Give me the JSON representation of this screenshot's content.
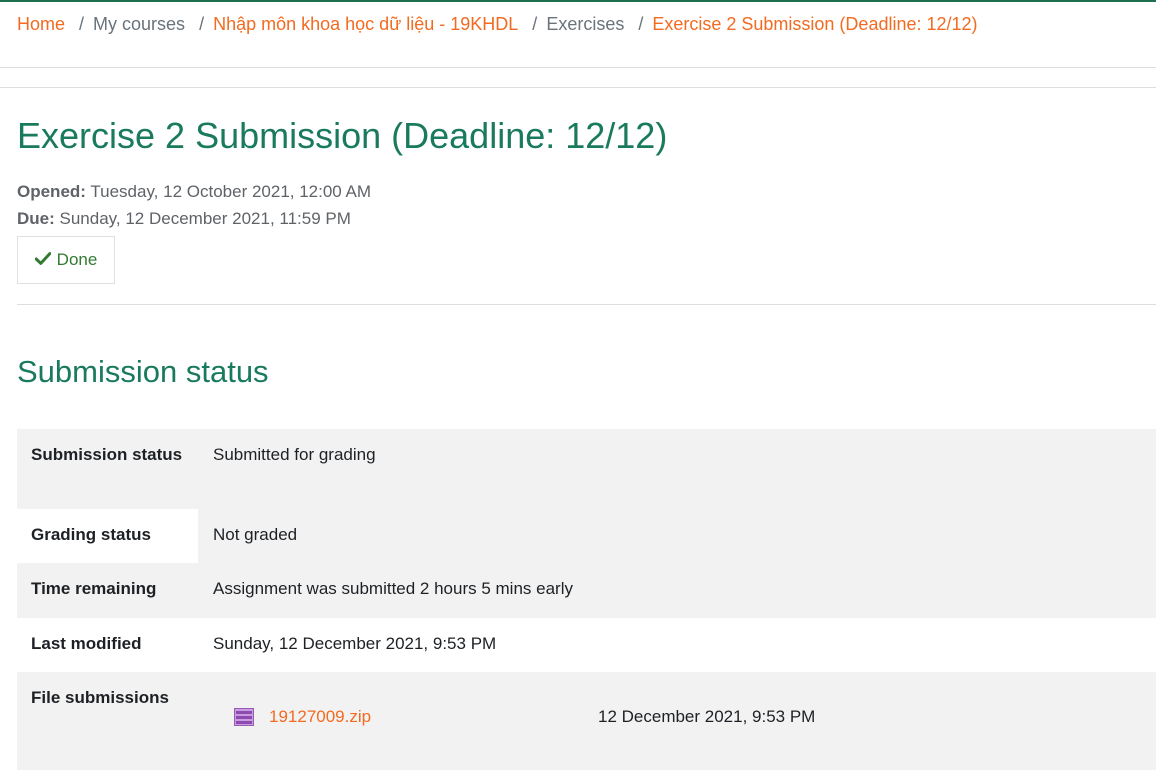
{
  "breadcrumb": {
    "home": "Home",
    "my_courses": "My courses",
    "course": "Nhập môn khoa học dữ liệu - 19KHDL",
    "exercises": "Exercises",
    "current": "Exercise 2 Submission (Deadline: 12/12)"
  },
  "page": {
    "title": "Exercise 2 Submission (Deadline: 12/12)",
    "opened_label": "Opened:",
    "opened_value": "Tuesday, 12 October 2021, 12:00 AM",
    "due_label": "Due:",
    "due_value": "Sunday, 12 December 2021, 11:59 PM",
    "done_label": "Done"
  },
  "submission": {
    "section_title": "Submission status",
    "rows": [
      {
        "label": "Submission status",
        "value": "Submitted for grading"
      },
      {
        "label": "Grading status",
        "value": "Not graded"
      },
      {
        "label": "Time remaining",
        "value": "Assignment was submitted 2 hours 5 mins early"
      },
      {
        "label": "Last modified",
        "value": "Sunday, 12 December 2021, 9:53 PM"
      },
      {
        "label": "File submissions",
        "file_name": "19127009.zip",
        "file_date": "12 December 2021, 9:53 PM"
      }
    ]
  },
  "colors": {
    "link": "#f26b21",
    "heading": "#1a7a5e",
    "done": "#357a32",
    "row_shade": "#f2f2f2"
  },
  "icons": {
    "done": "check-icon",
    "file": "archive-file-icon"
  }
}
